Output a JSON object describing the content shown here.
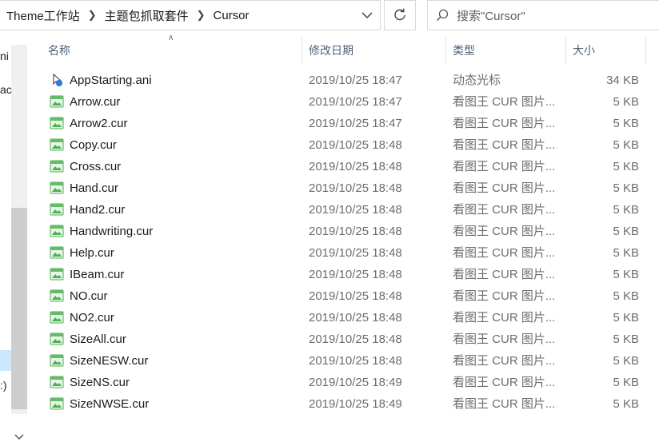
{
  "address": {
    "crumbs": [
      "Theme工作站",
      "主题包抓取套件",
      "Cursor"
    ]
  },
  "search": {
    "placeholder": "搜索\"Cursor\""
  },
  "nav": {
    "fragments": [
      "ni",
      "ac",
      ":)"
    ]
  },
  "columns": [
    {
      "label": "名称"
    },
    {
      "label": "修改日期"
    },
    {
      "label": "类型"
    },
    {
      "label": "大小"
    }
  ],
  "files": [
    {
      "name": "AppStarting.ani",
      "date": "2019/10/25 18:47",
      "type": "动态光标",
      "size": "34 KB",
      "icon": "animated-cursor-icon"
    },
    {
      "name": "Arrow.cur",
      "date": "2019/10/25 18:47",
      "type": "看图王 CUR 图片...",
      "size": "5 KB",
      "icon": "cur-image-icon"
    },
    {
      "name": "Arrow2.cur",
      "date": "2019/10/25 18:47",
      "type": "看图王 CUR 图片...",
      "size": "5 KB",
      "icon": "cur-image-icon"
    },
    {
      "name": "Copy.cur",
      "date": "2019/10/25 18:48",
      "type": "看图王 CUR 图片...",
      "size": "5 KB",
      "icon": "cur-image-icon"
    },
    {
      "name": "Cross.cur",
      "date": "2019/10/25 18:48",
      "type": "看图王 CUR 图片...",
      "size": "5 KB",
      "icon": "cur-image-icon"
    },
    {
      "name": "Hand.cur",
      "date": "2019/10/25 18:48",
      "type": "看图王 CUR 图片...",
      "size": "5 KB",
      "icon": "cur-image-icon"
    },
    {
      "name": "Hand2.cur",
      "date": "2019/10/25 18:48",
      "type": "看图王 CUR 图片...",
      "size": "5 KB",
      "icon": "cur-image-icon"
    },
    {
      "name": "Handwriting.cur",
      "date": "2019/10/25 18:48",
      "type": "看图王 CUR 图片...",
      "size": "5 KB",
      "icon": "cur-image-icon"
    },
    {
      "name": "Help.cur",
      "date": "2019/10/25 18:48",
      "type": "看图王 CUR 图片...",
      "size": "5 KB",
      "icon": "cur-image-icon"
    },
    {
      "name": "IBeam.cur",
      "date": "2019/10/25 18:48",
      "type": "看图王 CUR 图片...",
      "size": "5 KB",
      "icon": "cur-image-icon"
    },
    {
      "name": "NO.cur",
      "date": "2019/10/25 18:48",
      "type": "看图王 CUR 图片...",
      "size": "5 KB",
      "icon": "cur-image-icon"
    },
    {
      "name": "NO2.cur",
      "date": "2019/10/25 18:48",
      "type": "看图王 CUR 图片...",
      "size": "5 KB",
      "icon": "cur-image-icon"
    },
    {
      "name": "SizeAll.cur",
      "date": "2019/10/25 18:48",
      "type": "看图王 CUR 图片...",
      "size": "5 KB",
      "icon": "cur-image-icon"
    },
    {
      "name": "SizeNESW.cur",
      "date": "2019/10/25 18:48",
      "type": "看图王 CUR 图片...",
      "size": "5 KB",
      "icon": "cur-image-icon"
    },
    {
      "name": "SizeNS.cur",
      "date": "2019/10/25 18:49",
      "type": "看图王 CUR 图片...",
      "size": "5 KB",
      "icon": "cur-image-icon"
    },
    {
      "name": "SizeNWSE.cur",
      "date": "2019/10/25 18:49",
      "type": "看图王 CUR 图片...",
      "size": "5 KB",
      "icon": "cur-image-icon"
    }
  ],
  "colors": {
    "header_text": "#4c607a",
    "muted_text": "#6d6d6d",
    "icon_green": "#4caf50"
  }
}
